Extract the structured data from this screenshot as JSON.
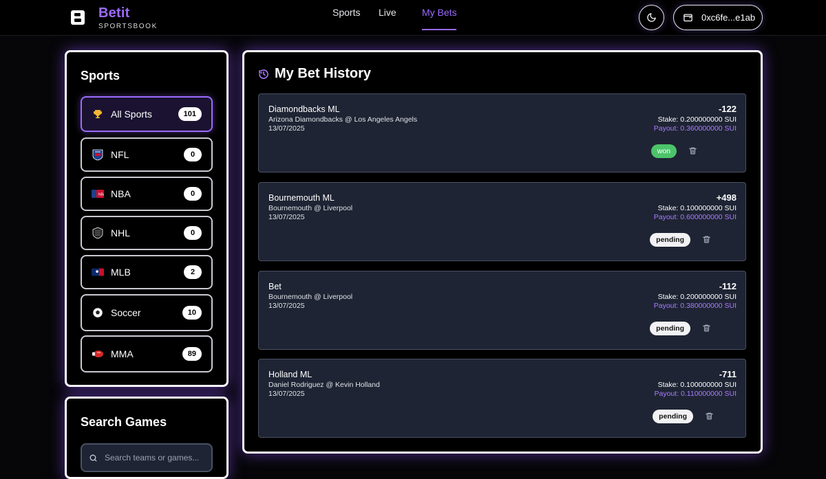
{
  "header": {
    "brand_name": "Betit",
    "brand_sub": "SPORTSBOOK",
    "nav": {
      "sports": "Sports",
      "live": "Live",
      "my_bets": "My Bets"
    },
    "wallet_address": "0xc6fe...e1ab",
    "accent_color": "#9b6bff"
  },
  "sidebar": {
    "title": "Sports",
    "items": [
      {
        "label": "All Sports",
        "count": "101",
        "icon": "trophy-icon"
      },
      {
        "label": "NFL",
        "count": "0",
        "icon": "nfl-logo-icon"
      },
      {
        "label": "NBA",
        "count": "0",
        "icon": "nba-logo-icon"
      },
      {
        "label": "NHL",
        "count": "0",
        "icon": "nhl-logo-icon"
      },
      {
        "label": "MLB",
        "count": "2",
        "icon": "mlb-logo-icon"
      },
      {
        "label": "Soccer",
        "count": "10",
        "icon": "soccer-ball-icon"
      },
      {
        "label": "MMA",
        "count": "89",
        "icon": "boxing-glove-icon"
      }
    ]
  },
  "search": {
    "title": "Search Games",
    "placeholder": "Search teams or games..."
  },
  "history": {
    "title": "My Bet History",
    "bets": [
      {
        "title": "Diamondbacks ML",
        "match": "Arizona Diamondbacks @ Los Angeles Angels",
        "date": "13/07/2025",
        "odds": "-122",
        "stake": "Stake: 0.200000000 SUI",
        "payout": "Payout: 0.360000000 SUI",
        "status": "won"
      },
      {
        "title": "Bournemouth ML",
        "match": "Bournemouth @ Liverpool",
        "date": "13/07/2025",
        "odds": "+498",
        "stake": "Stake: 0.100000000 SUI",
        "payout": "Payout: 0.600000000 SUI",
        "status": "pending"
      },
      {
        "title": "Bet",
        "match": "Bournemouth @ Liverpool",
        "date": "13/07/2025",
        "odds": "-112",
        "stake": "Stake: 0.200000000 SUI",
        "payout": "Payout: 0.380000000 SUI",
        "status": "pending"
      },
      {
        "title": "Holland ML",
        "match": "Daniel Rodriguez @ Kevin Holland",
        "date": "13/07/2025",
        "odds": "-711",
        "stake": "Stake: 0.100000000 SUI",
        "payout": "Payout: 0.110000000 SUI",
        "status": "pending"
      }
    ]
  }
}
